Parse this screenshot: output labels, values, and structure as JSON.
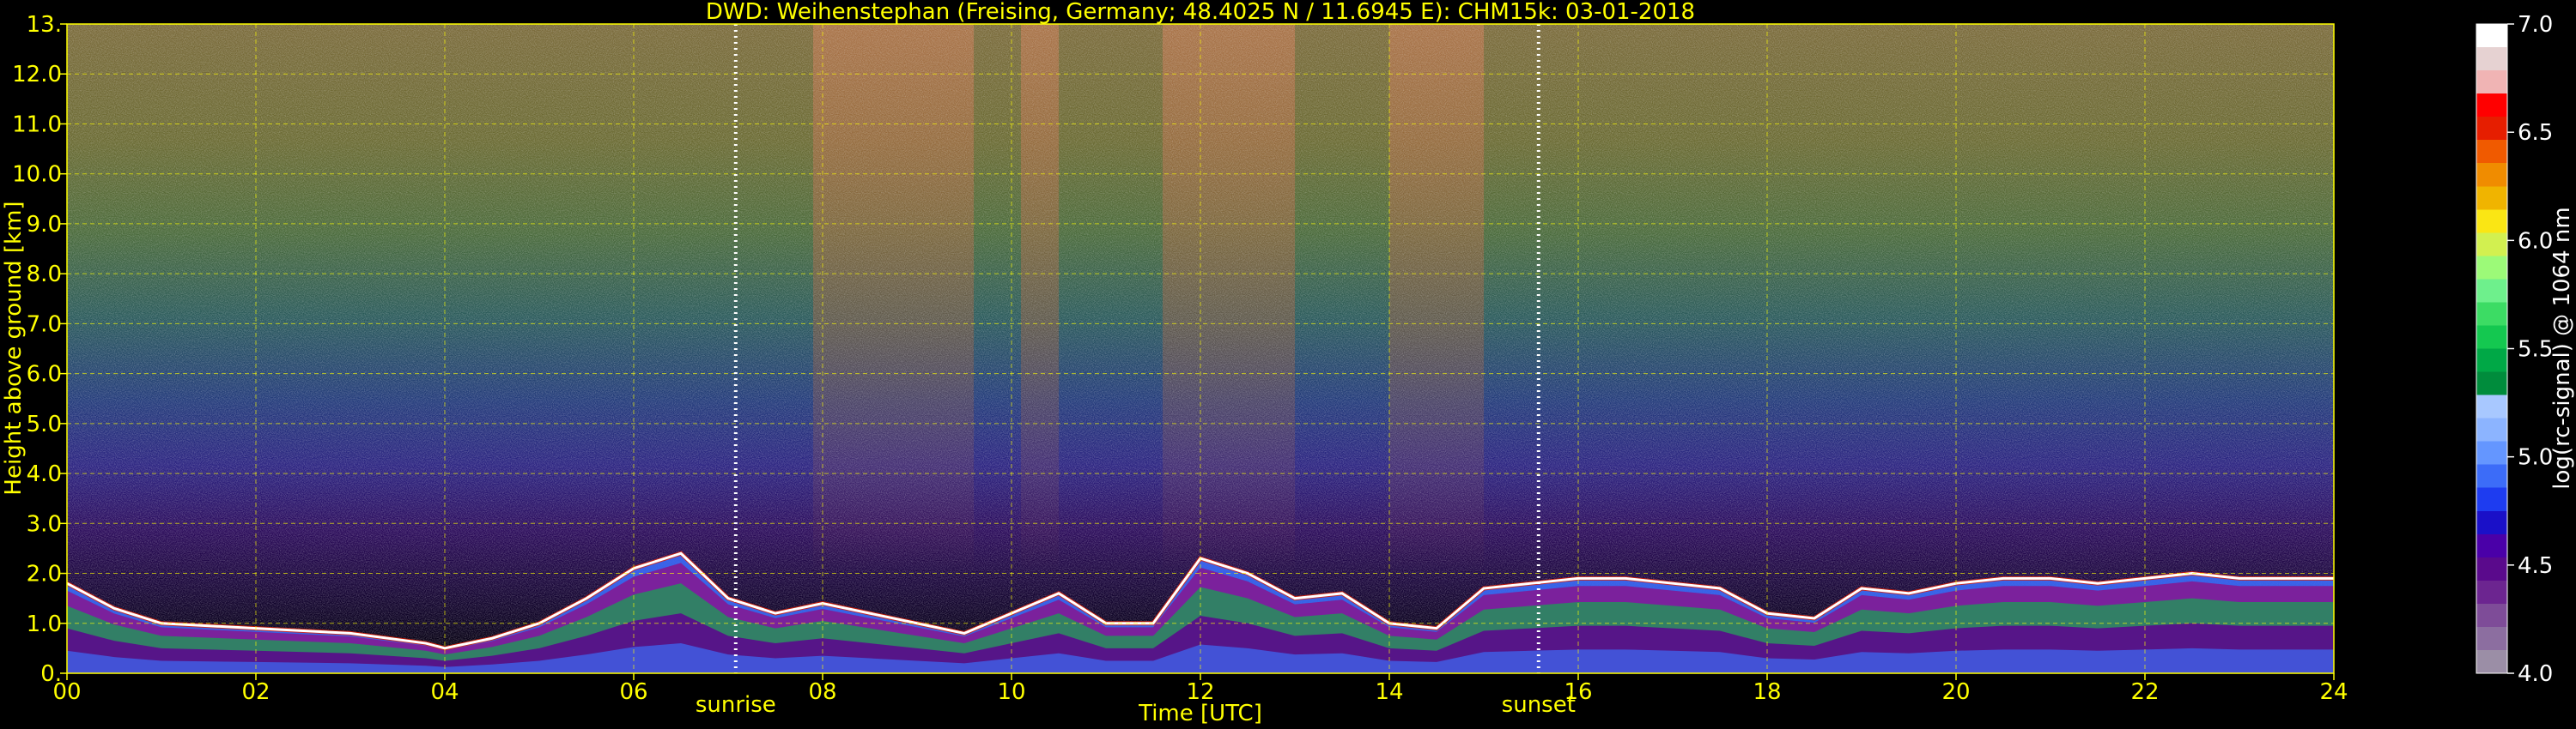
{
  "chart_data": {
    "type": "heatmap",
    "title": "DWD: Weihenstephan (Freising, Germany; 48.4025 N / 11.6945 E):    CHM15k: 03-01-2018",
    "xlabel": "Time [UTC]",
    "ylabel": "Height above ground [km]",
    "xlim": [
      0,
      24
    ],
    "ylim": [
      0,
      13
    ],
    "x_ticks": [
      "00",
      "02",
      "04",
      "06",
      "08",
      "10",
      "12",
      "14",
      "16",
      "18",
      "20",
      "22",
      "24"
    ],
    "x_tick_values": [
      0,
      2,
      4,
      6,
      8,
      10,
      12,
      14,
      16,
      18,
      20,
      22,
      24
    ],
    "y_ticks": [
      "0.",
      "1.0",
      "2.0",
      "3.0",
      "4.0",
      "5.0",
      "6.0",
      "7.0",
      "8.0",
      "9.0",
      "10.0",
      "11.0",
      "12.0",
      "13."
    ],
    "y_tick_values": [
      0,
      1,
      2,
      3,
      4,
      5,
      6,
      7,
      8,
      9,
      10,
      11,
      12,
      13
    ],
    "grid": true,
    "colorbar": {
      "label": "log(rc-signal) @ 1064 nm",
      "range": [
        4.0,
        7.0
      ],
      "ticks": [
        "4.0",
        "4.5",
        "5.0",
        "5.5",
        "6.0",
        "6.5",
        "7.0"
      ],
      "tick_values": [
        4.0,
        4.5,
        5.0,
        5.5,
        6.0,
        6.5,
        7.0
      ],
      "colors": [
        "#9b8ea6",
        "#8c6ea0",
        "#7e4c98",
        "#6c2590",
        "#5a0a8c",
        "#4a00a8",
        "#1a10c8",
        "#1e3cf0",
        "#3c6cf8",
        "#6496ff",
        "#8cb4ff",
        "#a8c8ff",
        "#008c3c",
        "#00a846",
        "#14c850",
        "#3cdc64",
        "#6ef08c",
        "#9cfa78",
        "#d2f050",
        "#fae614",
        "#f0b400",
        "#f08c00",
        "#f05a00",
        "#e61e00",
        "#ff0000",
        "#f0b4b4",
        "#e6d2d2",
        "#ffffff"
      ]
    },
    "markers": [
      {
        "label": "sunrise",
        "x": 7.08
      },
      {
        "label": "sunset",
        "x": 15.58
      }
    ],
    "features": {
      "boundary_layer_top_km": [
        [
          0.0,
          1.8
        ],
        [
          0.5,
          1.3
        ],
        [
          1.0,
          1.0
        ],
        [
          2.0,
          0.9
        ],
        [
          3.0,
          0.8
        ],
        [
          3.8,
          0.6
        ],
        [
          4.0,
          0.5
        ],
        [
          4.5,
          0.7
        ],
        [
          5.0,
          1.0
        ],
        [
          5.5,
          1.5
        ],
        [
          6.0,
          2.1
        ],
        [
          6.5,
          2.4
        ],
        [
          7.0,
          1.5
        ],
        [
          7.5,
          1.2
        ],
        [
          8.0,
          1.4
        ],
        [
          8.5,
          1.2
        ],
        [
          9.0,
          1.0
        ],
        [
          9.5,
          0.8
        ],
        [
          10.0,
          1.2
        ],
        [
          10.5,
          1.6
        ],
        [
          11.0,
          1.0
        ],
        [
          11.5,
          1.0
        ],
        [
          12.0,
          2.3
        ],
        [
          12.5,
          2.0
        ],
        [
          13.0,
          1.5
        ],
        [
          13.5,
          1.6
        ],
        [
          14.0,
          1.0
        ],
        [
          14.5,
          0.9
        ],
        [
          15.0,
          1.7
        ],
        [
          15.5,
          1.8
        ],
        [
          16.0,
          1.9
        ],
        [
          16.5,
          1.9
        ],
        [
          17.0,
          1.8
        ],
        [
          17.5,
          1.7
        ],
        [
          18.0,
          1.2
        ],
        [
          18.5,
          1.1
        ],
        [
          19.0,
          1.7
        ],
        [
          19.5,
          1.6
        ],
        [
          20.0,
          1.8
        ],
        [
          20.5,
          1.9
        ],
        [
          21.0,
          1.9
        ],
        [
          21.5,
          1.8
        ],
        [
          22.0,
          1.9
        ],
        [
          22.5,
          2.0
        ],
        [
          23.0,
          1.9
        ],
        [
          24.0,
          1.9
        ]
      ]
    }
  }
}
